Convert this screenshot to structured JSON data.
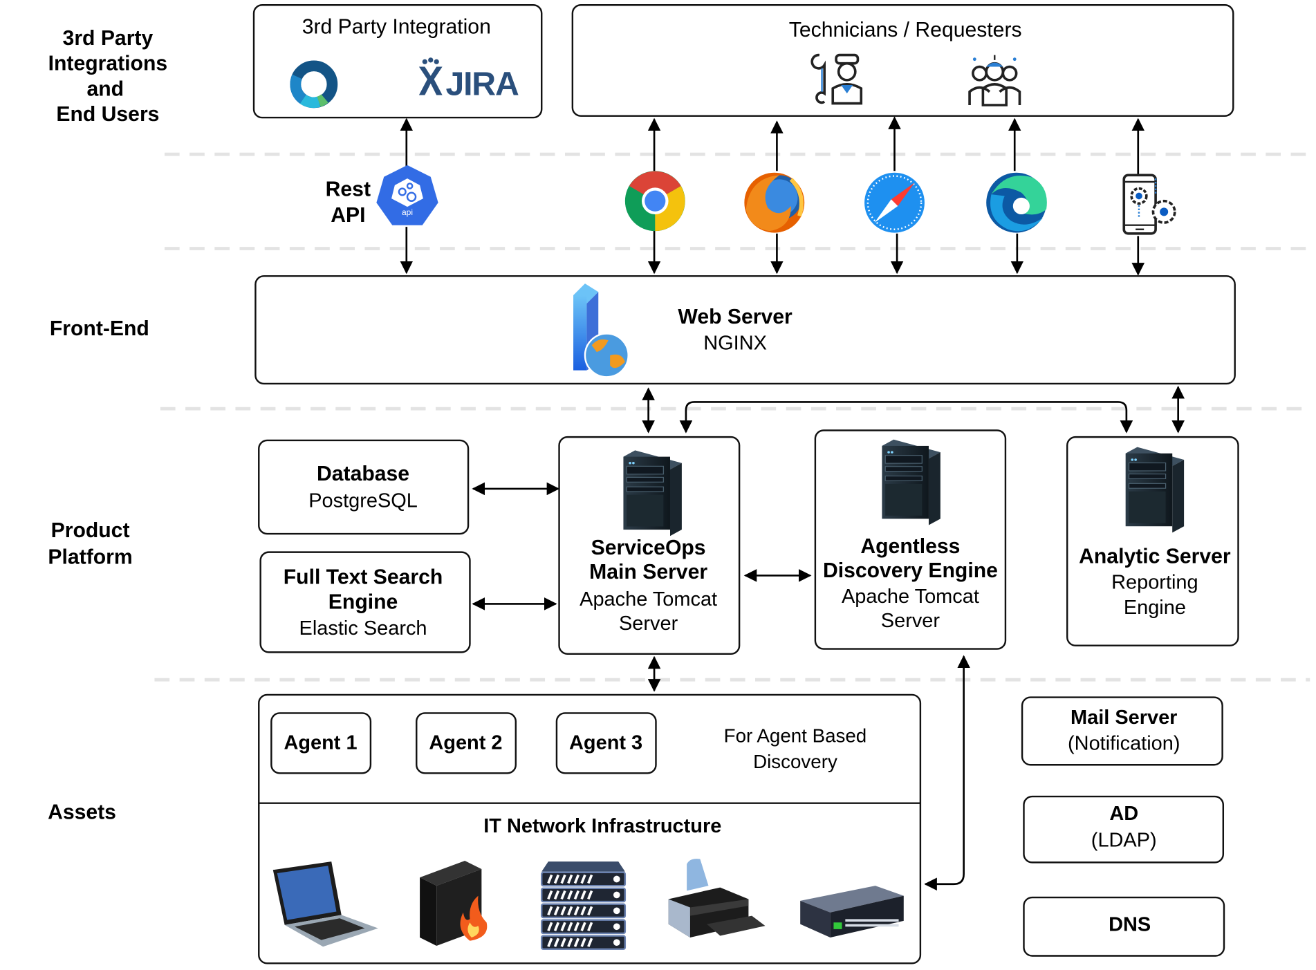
{
  "layers": {
    "integrations": [
      "3rd Party",
      "Integrations",
      "and",
      "End Users"
    ],
    "frontend": [
      "Front-End"
    ],
    "platform": [
      "Product",
      "Platform"
    ],
    "assets": [
      "Assets"
    ]
  },
  "integration_box": {
    "title": "3rd Party Integration",
    "logos": [
      "ring-logo",
      "JIRA"
    ],
    "jira_text": "JIRA"
  },
  "users_box": {
    "title": "Technicians / Requesters",
    "icons": [
      "technician-icon",
      "requesters-icon"
    ]
  },
  "rest_api": {
    "lines": [
      "Rest",
      "API"
    ],
    "badge_text": "api"
  },
  "clients": [
    "chrome",
    "firefox",
    "safari",
    "edge",
    "mobile-app"
  ],
  "web_server": {
    "title": "Web Server",
    "subtitle": "NGINX"
  },
  "database": {
    "title": "Database",
    "subtitle": "PostgreSQL"
  },
  "search_engine": {
    "title_lines": [
      "Full Text Search",
      "Engine"
    ],
    "subtitle": "Elastic Search"
  },
  "main_server": {
    "title_lines": [
      "ServiceOps",
      "Main Server"
    ],
    "subtitle_lines": [
      "Apache Tomcat",
      "Server"
    ]
  },
  "discovery_engine": {
    "title_lines": [
      "Agentless",
      "Discovery Engine"
    ],
    "subtitle_lines": [
      "Apache Tomcat",
      "Server"
    ]
  },
  "analytic_server": {
    "title": "Analytic Server",
    "subtitle_lines": [
      "Reporting",
      "Engine"
    ]
  },
  "agents": {
    "items": [
      "Agent 1",
      "Agent 2",
      "Agent 3"
    ],
    "note_lines": [
      "For Agent Based",
      "Discovery"
    ]
  },
  "infrastructure": {
    "title": "IT Network Infrastructure",
    "devices": [
      "laptop",
      "firewall",
      "server-rack",
      "printer",
      "network-switch"
    ]
  },
  "external_services": [
    {
      "title": "Mail Server",
      "subtitle": "(Notification)"
    },
    {
      "title": "AD",
      "subtitle": "(LDAP)"
    },
    {
      "title": "DNS",
      "subtitle": ""
    }
  ],
  "colors": {
    "api_blue": "#326ce5",
    "jira_blue": "#2a4f7c",
    "separator": "#e3e3e3",
    "server_dark": "#1e2a33"
  }
}
